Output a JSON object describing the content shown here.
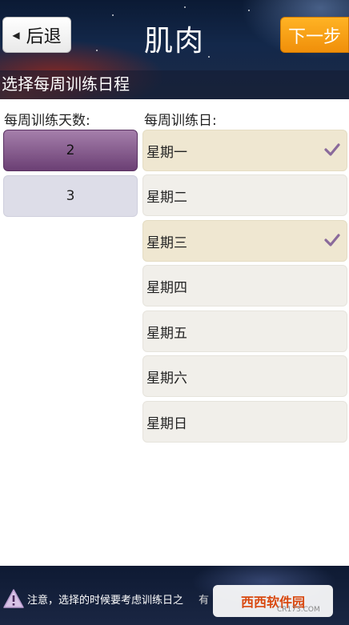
{
  "header": {
    "back_label": "后退",
    "title": "肌肉",
    "next_label": "下一步",
    "subtitle": "选择每周训练日程"
  },
  "columns": {
    "days_count_header": "每周训练天数:",
    "weekdays_header": "每周训练日:"
  },
  "day_counts": [
    {
      "label": "2",
      "selected": true
    },
    {
      "label": "3",
      "selected": false
    }
  ],
  "weekdays": [
    {
      "label": "星期一",
      "checked": true
    },
    {
      "label": "星期二",
      "checked": false
    },
    {
      "label": "星期三",
      "checked": true
    },
    {
      "label": "星期四",
      "checked": false
    },
    {
      "label": "星期五",
      "checked": false
    },
    {
      "label": "星期六",
      "checked": false
    },
    {
      "label": "星期日",
      "checked": false
    }
  ],
  "notice": {
    "text": "注意，选择的时候要考虑训练日之",
    "extra": "有",
    "watermark": "西西软件园",
    "watermark_sub": "CR173.COM"
  },
  "colors": {
    "accent_purple": "#6b3f74",
    "next_orange": "#f08f0a",
    "check_color": "#8a6a9b"
  }
}
